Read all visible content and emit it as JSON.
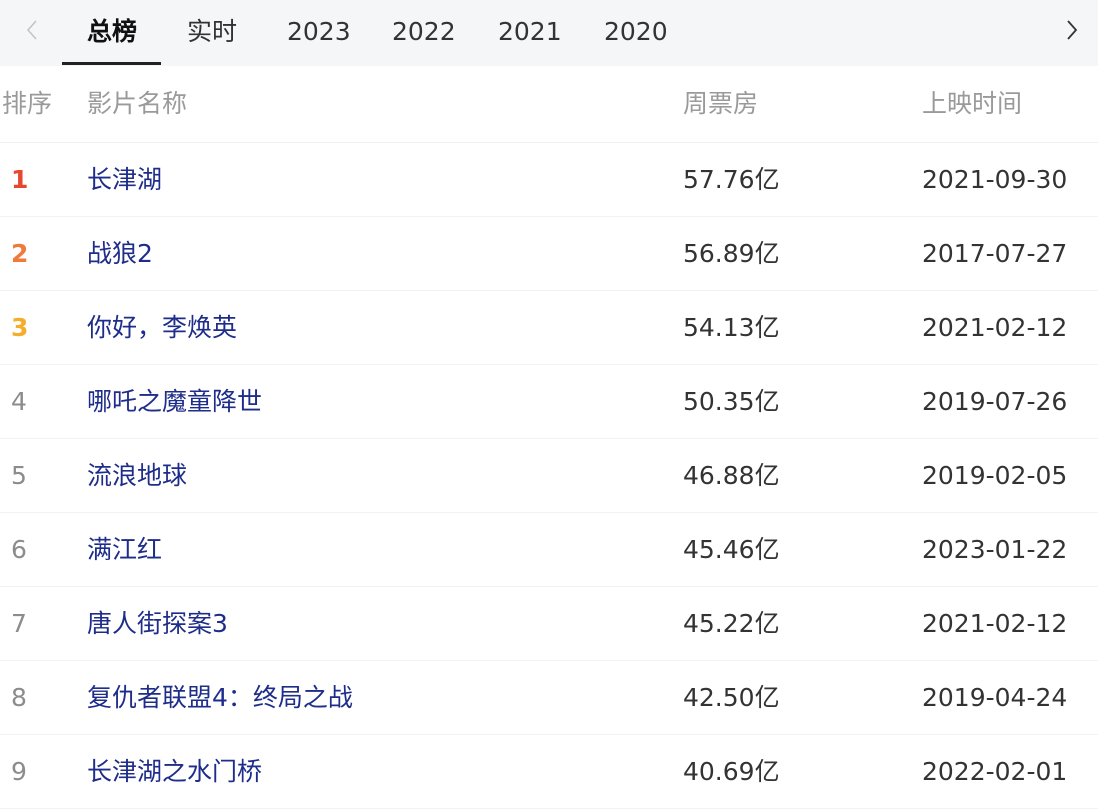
{
  "tabs": [
    {
      "label": "总榜",
      "active": true
    },
    {
      "label": "实时",
      "active": false
    },
    {
      "label": "2023",
      "active": false
    },
    {
      "label": "2022",
      "active": false
    },
    {
      "label": "2021",
      "active": false
    },
    {
      "label": "2020",
      "active": false
    }
  ],
  "nav": {
    "prev_icon": "chevron-left-icon",
    "next_icon": "chevron-right-icon"
  },
  "table": {
    "headers": {
      "rank": "排序",
      "name": "影片名称",
      "box_office": "周票房",
      "release_date": "上映时间"
    },
    "rows": [
      {
        "rank": "1",
        "name": "长津湖",
        "box_office": "57.76亿",
        "release_date": "2021-09-30"
      },
      {
        "rank": "2",
        "name": "战狼2",
        "box_office": "56.89亿",
        "release_date": "2017-07-27"
      },
      {
        "rank": "3",
        "name": "你好，李焕英",
        "box_office": "54.13亿",
        "release_date": "2021-02-12"
      },
      {
        "rank": "4",
        "name": "哪吒之魔童降世",
        "box_office": "50.35亿",
        "release_date": "2019-07-26"
      },
      {
        "rank": "5",
        "name": "流浪地球",
        "box_office": "46.88亿",
        "release_date": "2019-02-05"
      },
      {
        "rank": "6",
        "name": "满江红",
        "box_office": "45.46亿",
        "release_date": "2023-01-22"
      },
      {
        "rank": "7",
        "name": "唐人街探案3",
        "box_office": "45.22亿",
        "release_date": "2021-02-12"
      },
      {
        "rank": "8",
        "name": "复仇者联盟4：终局之战",
        "box_office": "42.50亿",
        "release_date": "2019-04-24"
      },
      {
        "rank": "9",
        "name": "长津湖之水门桥",
        "box_office": "40.69亿",
        "release_date": "2022-02-01"
      }
    ]
  },
  "colors": {
    "rank_1": "#e8472f",
    "rank_2": "#f07a3a",
    "rank_3": "#f5ad2a",
    "movie_name": "#1e2d8a",
    "tab_bar_bg": "#f5f6f8"
  }
}
